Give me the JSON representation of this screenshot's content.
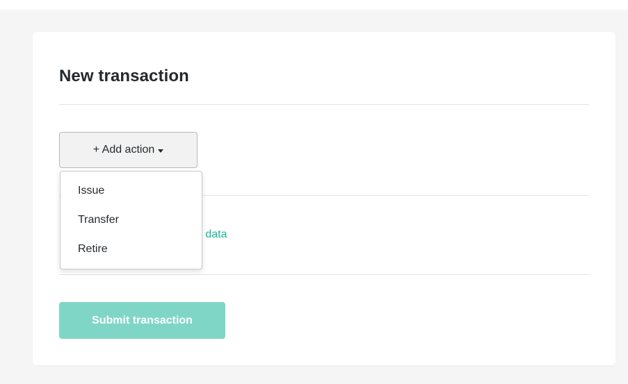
{
  "form": {
    "title": "New transaction",
    "add_action_label": "+ Add action",
    "link_fragment": "ce data",
    "submit_label": "Submit transaction"
  },
  "dropdown": {
    "items": [
      {
        "label": "Issue"
      },
      {
        "label": "Transfer"
      },
      {
        "label": "Retire"
      }
    ]
  },
  "colors": {
    "page_background": "#f5f5f5",
    "card_background": "#ffffff",
    "link": "#1ab394",
    "submit_button_disabled": "#7fd6c6"
  },
  "icons": {
    "add_action_caret": "chevron-down-icon"
  }
}
